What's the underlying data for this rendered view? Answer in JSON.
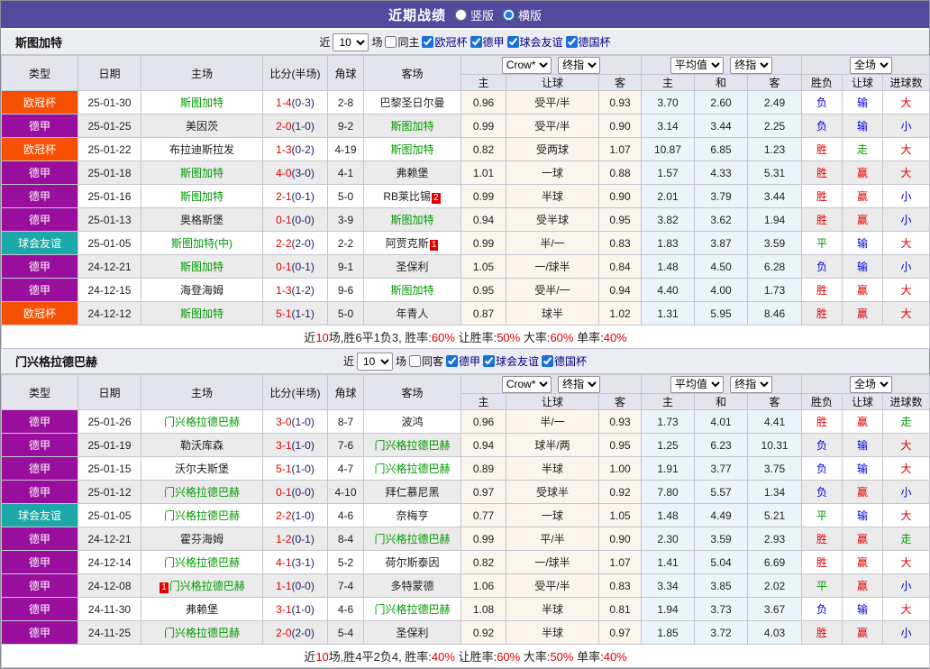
{
  "title_bar": {
    "title": "近期战绩",
    "radio_vertical": "竖版",
    "radio_horizontal": "横版"
  },
  "filters": {
    "near_label": "近",
    "count": "10",
    "games_label": "场"
  },
  "table_header": {
    "col_type": "类型",
    "col_date": "日期",
    "col_home": "主场",
    "col_score": "比分(半场)",
    "col_corner": "角球",
    "col_away": "客场",
    "dd_crown": "Crow*",
    "dd_final1": "终指",
    "dd_avg": "平均值",
    "dd_final2": "终指",
    "dd_full": "全场",
    "sub_home": "主",
    "sub_handicap": "让球",
    "sub_away": "客",
    "sub_avg_home": "主",
    "sub_draw": "和",
    "sub_avg_away": "客",
    "sub_result": "胜负",
    "sub_rq": "让球",
    "sub_goals": "进球数"
  },
  "colors": {
    "title_bg": "#544a9d",
    "league_dejia": "#9a0e9d",
    "league_ouguan": "#f75000",
    "league_youyi": "#1ca8a8",
    "team_green": "#009900",
    "win_red": "#e00000",
    "lose_blue": "#0000d8",
    "draw_green": "#009900",
    "crown_col_bg": "#fdf5ec",
    "avg_col_bg": "#eaf5fb"
  },
  "sections": [
    {
      "team": "斯图加特",
      "same_label": "同主",
      "leagues": [
        "欧冠杯",
        "德甲",
        "球会友谊",
        "德国杯"
      ],
      "rows": [
        {
          "league": "欧冠杯",
          "date": "25-01-30",
          "home": "斯图加特",
          "home_green": true,
          "score": "1-4",
          "half": "(0-3)",
          "corner": "2-8",
          "away": "巴黎圣日尔曼",
          "crown": [
            "0.96",
            "受平/半",
            "0.93"
          ],
          "avg": [
            "3.70",
            "2.60",
            "2.49"
          ],
          "full": [
            "负",
            "输",
            "大"
          ]
        },
        {
          "league": "德甲",
          "date": "25-01-25",
          "home": "美因茨",
          "score": "2-0",
          "half": "(1-0)",
          "corner": "9-2",
          "away": "斯图加特",
          "away_green": true,
          "crown": [
            "0.99",
            "受平/半",
            "0.90"
          ],
          "avg": [
            "3.14",
            "3.44",
            "2.25"
          ],
          "full": [
            "负",
            "输",
            "小"
          ]
        },
        {
          "league": "欧冠杯",
          "date": "25-01-22",
          "home": "布拉迪斯拉发",
          "score": "1-3",
          "half": "(0-2)",
          "corner": "4-19",
          "away": "斯图加特",
          "away_green": true,
          "crown": [
            "0.82",
            "受两球",
            "1.07"
          ],
          "avg": [
            "10.87",
            "6.85",
            "1.23"
          ],
          "full": [
            "胜",
            "走",
            "大"
          ]
        },
        {
          "league": "德甲",
          "date": "25-01-18",
          "home": "斯图加特",
          "home_green": true,
          "score": "4-0",
          "half": "(3-0)",
          "corner": "4-1",
          "away": "弗赖堡",
          "crown": [
            "1.01",
            "一球",
            "0.88"
          ],
          "avg": [
            "1.57",
            "4.33",
            "5.31"
          ],
          "full": [
            "胜",
            "赢",
            "大"
          ]
        },
        {
          "league": "德甲",
          "date": "25-01-16",
          "home": "斯图加特",
          "home_green": true,
          "score": "2-1",
          "half": "(0-1)",
          "corner": "5-0",
          "away": "RB莱比锡",
          "away_badge": "2",
          "crown": [
            "0.99",
            "半球",
            "0.90"
          ],
          "avg": [
            "2.01",
            "3.79",
            "3.44"
          ],
          "full": [
            "胜",
            "赢",
            "小"
          ]
        },
        {
          "league": "德甲",
          "date": "25-01-13",
          "home": "奥格斯堡",
          "score": "0-1",
          "half": "(0-0)",
          "corner": "3-9",
          "away": "斯图加特",
          "away_green": true,
          "crown": [
            "0.94",
            "受半球",
            "0.95"
          ],
          "avg": [
            "3.82",
            "3.62",
            "1.94"
          ],
          "full": [
            "胜",
            "赢",
            "小"
          ]
        },
        {
          "league": "球会友谊",
          "date": "25-01-05",
          "home": "斯图加特(中)",
          "home_green": true,
          "score": "2-2",
          "half": "(2-0)",
          "corner": "2-2",
          "away": "阿贾克斯",
          "away_badge": "1",
          "crown": [
            "0.99",
            "半/一",
            "0.83"
          ],
          "avg": [
            "1.83",
            "3.87",
            "3.59"
          ],
          "full": [
            "平",
            "输",
            "大"
          ]
        },
        {
          "league": "德甲",
          "date": "24-12-21",
          "home": "斯图加特",
          "home_green": true,
          "score": "0-1",
          "half": "(0-1)",
          "corner": "9-1",
          "away": "圣保利",
          "crown": [
            "1.05",
            "一/球半",
            "0.84"
          ],
          "avg": [
            "1.48",
            "4.50",
            "6.28"
          ],
          "full": [
            "负",
            "输",
            "小"
          ]
        },
        {
          "league": "德甲",
          "date": "24-12-15",
          "home": "海登海姆",
          "score": "1-3",
          "half": "(1-2)",
          "corner": "9-6",
          "away": "斯图加特",
          "away_green": true,
          "crown": [
            "0.95",
            "受半/一",
            "0.94"
          ],
          "avg": [
            "4.40",
            "4.00",
            "1.73"
          ],
          "full": [
            "胜",
            "赢",
            "大"
          ]
        },
        {
          "league": "欧冠杯",
          "date": "24-12-12",
          "home": "斯图加特",
          "home_green": true,
          "score": "5-1",
          "half": "(1-1)",
          "corner": "5-0",
          "away": "年青人",
          "crown": [
            "0.87",
            "球半",
            "1.02"
          ],
          "avg": [
            "1.31",
            "5.95",
            "8.46"
          ],
          "full": [
            "胜",
            "赢",
            "大"
          ]
        }
      ],
      "summary": [
        {
          "t": "近"
        },
        {
          "t": "10",
          "red": true
        },
        {
          "t": "场,胜6平1负3, 胜率:"
        },
        {
          "t": "60%",
          "red": true
        },
        {
          "t": " 让胜率:"
        },
        {
          "t": "50%",
          "red": true
        },
        {
          "t": " 大率:"
        },
        {
          "t": "60%",
          "red": true
        },
        {
          "t": " 单率:"
        },
        {
          "t": "40%",
          "red": true
        }
      ]
    },
    {
      "team": "门兴格拉德巴赫",
      "same_label": "同客",
      "leagues": [
        "德甲",
        "球会友谊",
        "德国杯"
      ],
      "rows": [
        {
          "league": "德甲",
          "date": "25-01-26",
          "home": "门兴格拉德巴赫",
          "home_green": true,
          "score": "3-0",
          "half": "(1-0)",
          "corner": "8-7",
          "away": "波鸿",
          "crown": [
            "0.96",
            "半/一",
            "0.93"
          ],
          "avg": [
            "1.73",
            "4.01",
            "4.41"
          ],
          "full": [
            "胜",
            "赢",
            "走"
          ]
        },
        {
          "league": "德甲",
          "date": "25-01-19",
          "home": "勒沃库森",
          "score": "3-1",
          "half": "(1-0)",
          "corner": "7-6",
          "away": "门兴格拉德巴赫",
          "away_green": true,
          "crown": [
            "0.94",
            "球半/两",
            "0.95"
          ],
          "avg": [
            "1.25",
            "6.23",
            "10.31"
          ],
          "full": [
            "负",
            "输",
            "大"
          ]
        },
        {
          "league": "德甲",
          "date": "25-01-15",
          "home": "沃尔夫斯堡",
          "score": "5-1",
          "half": "(1-0)",
          "corner": "4-7",
          "away": "门兴格拉德巴赫",
          "away_green": true,
          "crown": [
            "0.89",
            "半球",
            "1.00"
          ],
          "avg": [
            "1.91",
            "3.77",
            "3.75"
          ],
          "full": [
            "负",
            "输",
            "大"
          ]
        },
        {
          "league": "德甲",
          "date": "25-01-12",
          "home": "门兴格拉德巴赫",
          "home_green": true,
          "score": "0-1",
          "half": "(0-0)",
          "corner": "4-10",
          "away": "拜仁慕尼黑",
          "crown": [
            "0.97",
            "受球半",
            "0.92"
          ],
          "avg": [
            "7.80",
            "5.57",
            "1.34"
          ],
          "full": [
            "负",
            "赢",
            "小"
          ]
        },
        {
          "league": "球会友谊",
          "date": "25-01-05",
          "home": "门兴格拉德巴赫",
          "home_green": true,
          "score": "2-2",
          "half": "(1-0)",
          "corner": "4-6",
          "away": "奈梅亨",
          "crown": [
            "0.77",
            "一球",
            "1.05"
          ],
          "avg": [
            "1.48",
            "4.49",
            "5.21"
          ],
          "full": [
            "平",
            "输",
            "大"
          ]
        },
        {
          "league": "德甲",
          "date": "24-12-21",
          "home": "霍芬海姆",
          "score": "1-2",
          "half": "(0-1)",
          "corner": "8-4",
          "away": "门兴格拉德巴赫",
          "away_green": true,
          "crown": [
            "0.99",
            "平/半",
            "0.90"
          ],
          "avg": [
            "2.30",
            "3.59",
            "2.93"
          ],
          "full": [
            "胜",
            "赢",
            "走"
          ]
        },
        {
          "league": "德甲",
          "date": "24-12-14",
          "home": "门兴格拉德巴赫",
          "home_green": true,
          "score": "4-1",
          "half": "(3-1)",
          "corner": "5-2",
          "away": "荷尔斯泰因",
          "crown": [
            "0.82",
            "一/球半",
            "1.07"
          ],
          "avg": [
            "1.41",
            "5.04",
            "6.69"
          ],
          "full": [
            "胜",
            "赢",
            "大"
          ]
        },
        {
          "league": "德甲",
          "date": "24-12-08",
          "home": "门兴格拉德巴赫",
          "home_green": true,
          "home_badge": "1",
          "score": "1-1",
          "half": "(0-0)",
          "corner": "7-4",
          "away": "多特蒙德",
          "crown": [
            "1.06",
            "受平/半",
            "0.83"
          ],
          "avg": [
            "3.34",
            "3.85",
            "2.02"
          ],
          "full": [
            "平",
            "赢",
            "小"
          ]
        },
        {
          "league": "德甲",
          "date": "24-11-30",
          "home": "弗赖堡",
          "score": "3-1",
          "half": "(1-0)",
          "corner": "4-6",
          "away": "门兴格拉德巴赫",
          "away_green": true,
          "crown": [
            "1.08",
            "半球",
            "0.81"
          ],
          "avg": [
            "1.94",
            "3.73",
            "3.67"
          ],
          "full": [
            "负",
            "输",
            "大"
          ]
        },
        {
          "league": "德甲",
          "date": "24-11-25",
          "home": "门兴格拉德巴赫",
          "home_green": true,
          "score": "2-0",
          "half": "(2-0)",
          "corner": "5-4",
          "away": "圣保利",
          "crown": [
            "0.92",
            "半球",
            "0.97"
          ],
          "avg": [
            "1.85",
            "3.72",
            "4.03"
          ],
          "full": [
            "胜",
            "赢",
            "小"
          ]
        }
      ],
      "summary": [
        {
          "t": "近"
        },
        {
          "t": "10",
          "red": true
        },
        {
          "t": "场,胜4平2负4, 胜率:"
        },
        {
          "t": "40%",
          "red": true
        },
        {
          "t": " 让胜率:"
        },
        {
          "t": "60%",
          "red": true
        },
        {
          "t": " 大率:"
        },
        {
          "t": "50%",
          "red": true
        },
        {
          "t": " 单率:"
        },
        {
          "t": "40%",
          "red": true
        }
      ]
    }
  ]
}
